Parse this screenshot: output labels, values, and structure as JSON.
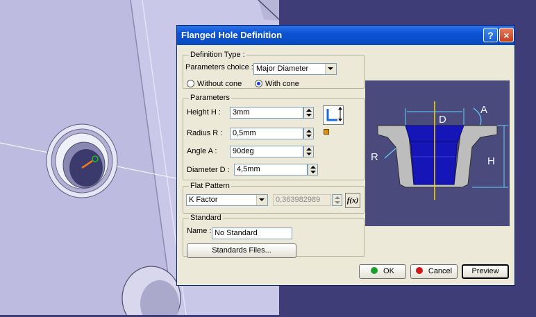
{
  "dialog": {
    "title": "Flanged Hole Definition",
    "help_icon": "?",
    "close_icon": "×"
  },
  "definition_type": {
    "group_label": "Definition Type :",
    "params_choice_label": "Parameters choice :",
    "params_choice_value": "Major Diameter",
    "without_cone_label": "Without cone",
    "with_cone_label": "With cone",
    "selected": "With cone"
  },
  "parameters": {
    "group_label": "Parameters",
    "height_label": "Height H  :",
    "height_value": "3mm",
    "radius_label": "Radius R  :",
    "radius_value": "0,5mm",
    "angle_label": "Angle A   :",
    "angle_value": "90deg",
    "diameter_label": "Diameter D :",
    "diameter_value": "4,5mm",
    "orientation_icon": "flange-direction-icon"
  },
  "flat_pattern": {
    "group_label": "Flat Pattern",
    "type_value": "K Factor",
    "kfactor_value": "0,363982989",
    "formula_icon": "f(x)"
  },
  "standard": {
    "group_label": "Standard",
    "name_label": "Name :",
    "name_value": "No Standard",
    "files_button": "Standards Files..."
  },
  "diagram": {
    "label_d": "D",
    "label_a": "A",
    "label_r": "R",
    "label_h": "H"
  },
  "buttons": {
    "ok": "OK",
    "cancel": "Cancel",
    "preview": "Preview"
  },
  "colors": {
    "title_bar": "#0b53d4",
    "dialog_bg": "#ece9d8",
    "viewport_bg": "#3f3d78",
    "part_surface": "#c8c8e8",
    "ok_green": "#1aa02c",
    "cancel_red": "#d01818",
    "diagram_bg": "#4a4a7c"
  }
}
